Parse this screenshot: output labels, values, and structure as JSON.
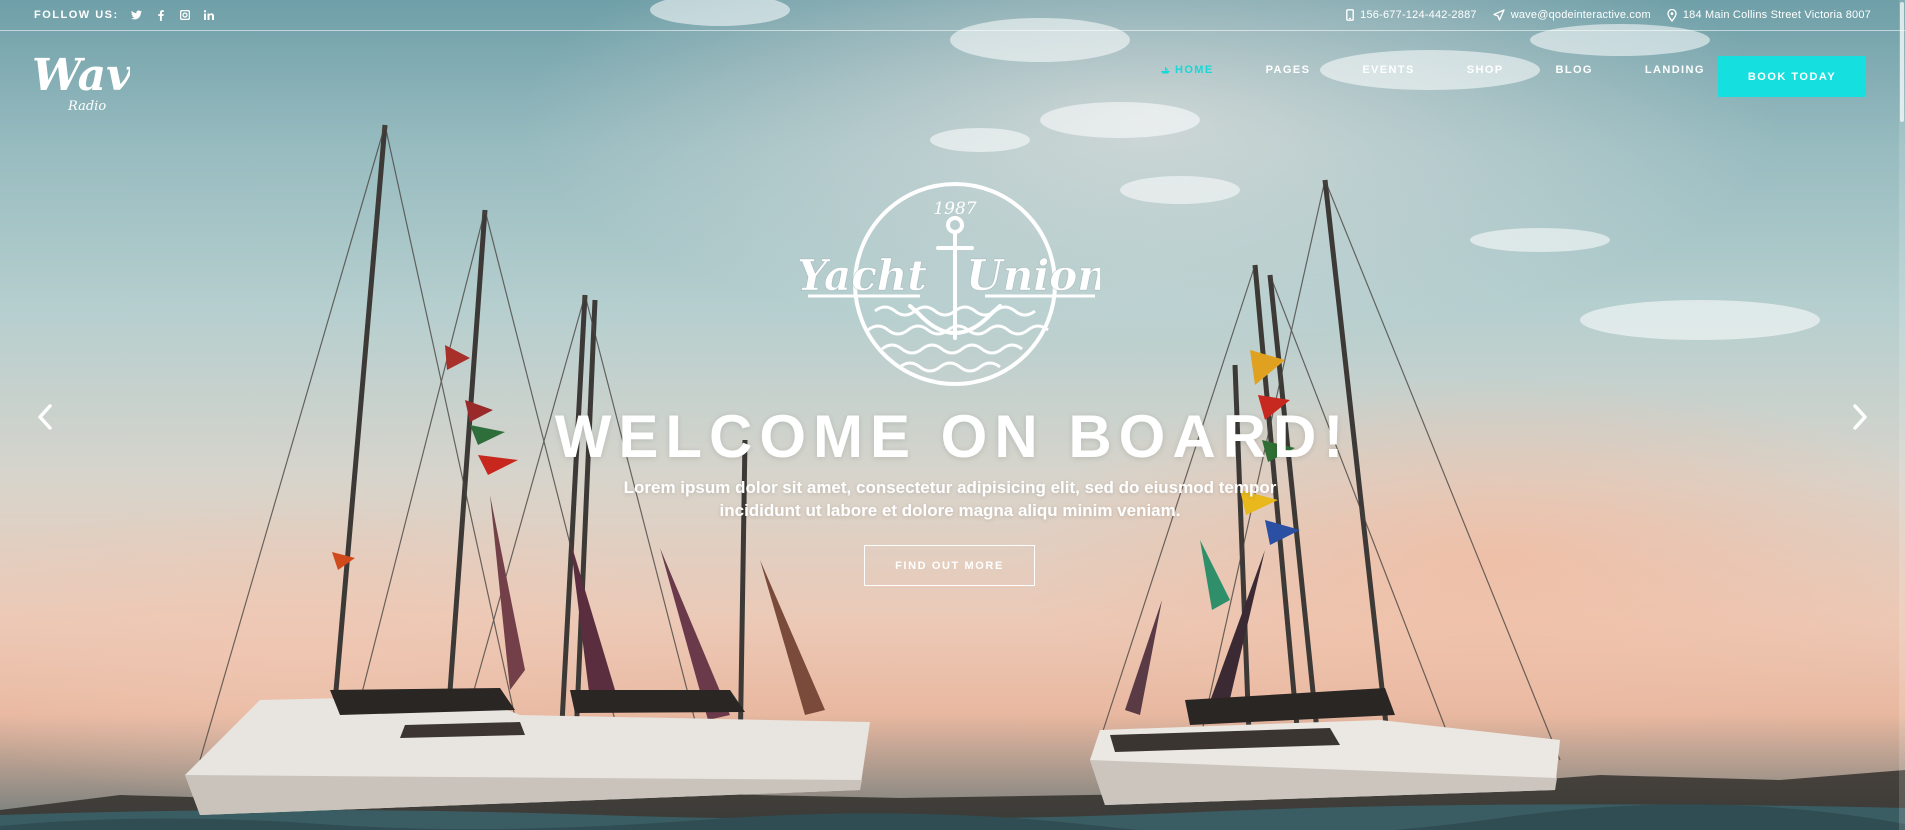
{
  "topbar": {
    "follow_label": "FOLLOW US:",
    "social_icons": [
      "twitter-icon",
      "facebook-icon",
      "instagram-icon",
      "linkedin-icon"
    ],
    "phone": "156-677-124-442-2887",
    "email": "wave@qodeinteractive.com",
    "address": "184 Main Collins Street Victoria 8007"
  },
  "logo": {
    "text": "Wave",
    "subtext": "Radio"
  },
  "nav": {
    "items": [
      {
        "label": "HOME",
        "active": true
      },
      {
        "label": "PAGES",
        "active": false
      },
      {
        "label": "EVENTS",
        "active": false
      },
      {
        "label": "SHOP",
        "active": false
      },
      {
        "label": "BLOG",
        "active": false
      },
      {
        "label": "LANDING",
        "active": false
      }
    ]
  },
  "cta": {
    "book_label": "BOOK TODAY"
  },
  "hero": {
    "badge_year": "1987",
    "badge_left": "Yacht",
    "badge_right": "Union",
    "headline": "WELCOME ON BOARD!",
    "sub_line1": "Lorem ipsum dolor sit amet, consectetur adipisicing elit, sed do eiusmod tempor",
    "sub_line2": "incididunt ut labore et dolore magna aliqu minim veniam.",
    "button_label": "FIND OUT MORE"
  },
  "colors": {
    "accent": "#15dfdf",
    "text": "#ffffff"
  }
}
